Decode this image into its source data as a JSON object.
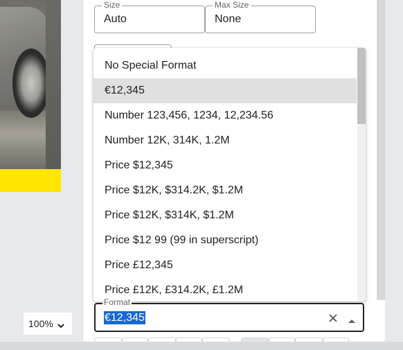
{
  "fields": {
    "size": {
      "label": "Size",
      "value": "Auto"
    },
    "max_size": {
      "label": "Max Size",
      "value": "None"
    }
  },
  "dropdown": {
    "selected_index": 1,
    "options": [
      "No Special Format",
      "€12,345",
      "Number 123,456, 1234, 12,234.56",
      "Number 12K, 314K, 1.2M",
      "Price $12,345",
      "Price $12K, $314.2K, $1.2M",
      "Price $12K, $314K, $1.2M",
      "Price $12 99 (99 in superscript)",
      "Price £12,345",
      "Price £12K, £314.2K, £1.2M"
    ]
  },
  "format": {
    "label": "Format",
    "value": "€12,345",
    "clear_icon": "close-icon",
    "toggle_icon": "arrow-up-icon"
  },
  "zoom": {
    "value": "100%",
    "icon": "chevron-down-icon"
  },
  "colors": {
    "selection_highlight": "#1967d2",
    "selected_option_bg": "#e0e0e0",
    "brand_yellow": "#ffe600"
  }
}
